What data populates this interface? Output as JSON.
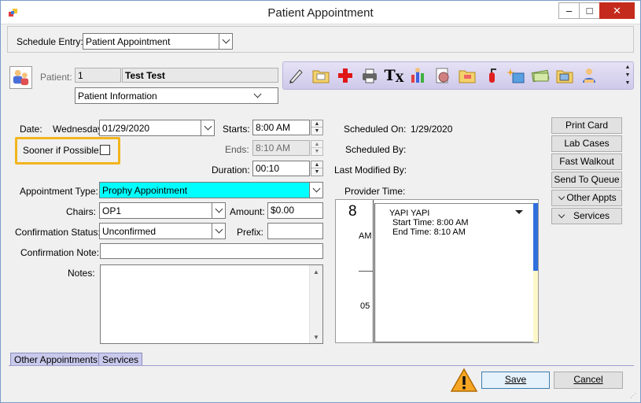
{
  "window": {
    "title": "Patient Appointment",
    "controls": {
      "minimize": "–",
      "maximize": "□",
      "close": "✕"
    }
  },
  "schedule_entry": {
    "label": "Schedule Entry:",
    "value": "Patient Appointment"
  },
  "patient": {
    "label": "Patient:",
    "id": "1",
    "name": "Test Test",
    "info_dropdown": "Patient Information"
  },
  "toolbar_icons": [
    "edit-pen-icon",
    "folder-note-icon",
    "medical-cross-icon",
    "printer-icon",
    "rx-icon",
    "family-chart-icon",
    "brain-scan-icon",
    "folder-tooth-icon",
    "fire-extinguisher-icon",
    "sparkle-folder-icon",
    "cash-icon",
    "folder-image-icon",
    "user-hand-icon"
  ],
  "form": {
    "date_label": "Date:",
    "date_day": "Wednesday",
    "date_value": "01/29/2020",
    "sooner_label": "Sooner if Possible:",
    "starts_label": "Starts:",
    "starts_value": "8:00 AM",
    "ends_label": "Ends:",
    "ends_value": "8:10 AM",
    "duration_label": "Duration:",
    "duration_value": "00:10",
    "appt_type_label": "Appointment Type:",
    "appt_type_value": "Prophy Appointment",
    "chairs_label": "Chairs:",
    "chairs_value": "OP1",
    "amount_label": "Amount:",
    "amount_value": "$0.00",
    "confirm_status_label": "Confirmation Status:",
    "confirm_status_value": "Unconfirmed",
    "prefix_label": "Prefix:",
    "prefix_value": "",
    "confirm_note_label": "Confirmation Note:",
    "confirm_note_value": "",
    "notes_label": "Notes:",
    "notes_value": ""
  },
  "info": {
    "scheduled_on_label": "Scheduled On:",
    "scheduled_on_value": "1/29/2020",
    "scheduled_by_label": "Scheduled By:",
    "last_modified_label": "Last Modified By:",
    "provider_time_label": "Provider Time:"
  },
  "provider_calendar": {
    "hour": "8",
    "am": "AM",
    "minute": "05",
    "appt_title": "YAPI YAPI",
    "appt_start": "Start Time: 8:00 AM",
    "appt_end": "End Time: 8:10 AM",
    "appt_color": "#2f6fdc"
  },
  "buttons": {
    "print_card": "Print Card",
    "lab_cases": "Lab Cases",
    "fast_walkout": "Fast Walkout",
    "send_to_queue": "Send To Queue",
    "other_appts": "Other Appts",
    "services": "Services",
    "save": "Save",
    "cancel": "Cancel"
  },
  "tabs": {
    "other_appointments": "Other Appointments",
    "services": "Services"
  },
  "colors": {
    "highlight": "#f2b41f",
    "appt_type_bg": "#00ffff",
    "tab_bg": "#c9c9ec"
  }
}
